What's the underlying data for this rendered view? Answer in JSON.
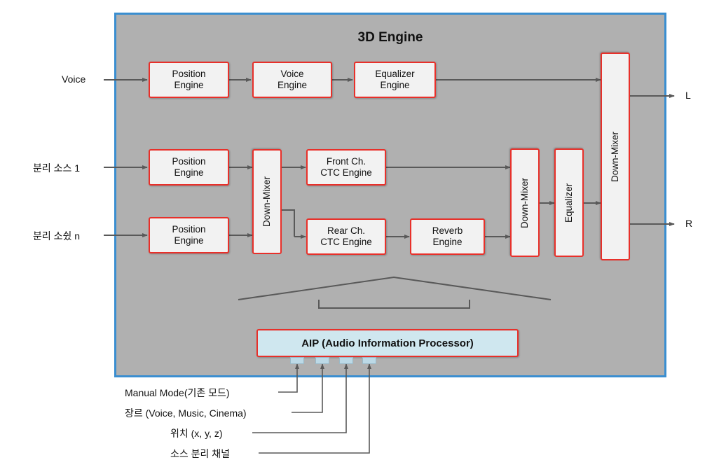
{
  "diagram": {
    "title": "3D Engine",
    "inputs": [
      {
        "label": "Voice"
      },
      {
        "label": "분리 소스 1"
      },
      {
        "label": "분리 소슀 n"
      }
    ],
    "outputs": [
      {
        "label": "L"
      },
      {
        "label": "R"
      }
    ],
    "blocks": {
      "position_engine_1": "Position\nEngine",
      "position_engine_1_l1": "Position",
      "position_engine_1_l2": "Engine",
      "voice_engine_l1": "Voice",
      "voice_engine_l2": "Engine",
      "equalizer_engine_l1": "Equalizer",
      "equalizer_engine_l2": "Engine",
      "position_engine_2_l1": "Position",
      "position_engine_2_l2": "Engine",
      "position_engine_3_l1": "Position",
      "position_engine_3_l2": "Engine",
      "down_mixer_left": "Down-Mixer",
      "front_ctc_l1": "Front Ch.",
      "front_ctc_l2": "CTC Engine",
      "rear_ctc_l1": "Rear Ch.",
      "rear_ctc_l2": "CTC Engine",
      "reverb_engine_l1": "Reverb",
      "reverb_engine_l2": "Engine",
      "down_mixer_mid": "Down-Mixer",
      "equalizer_mid": "Equalizer",
      "down_mixer_out": "Down-Mixer",
      "aip": "AIP (Audio Information Processor)"
    },
    "annotations": [
      {
        "label": "Manual Mode(기존 모드)"
      },
      {
        "label": "장르 (Voice, Music, Cinema)"
      },
      {
        "label": "위치 (x, y, z)"
      },
      {
        "label": "소스 분리 채널"
      }
    ],
    "colors": {
      "panel_background": "#b0b0b0",
      "panel_border": "#3a8ed0",
      "block_border": "#e8302a",
      "block_fill": "#f2f2f2",
      "aip_fill": "#cfe7ef",
      "wire": "#595959"
    }
  }
}
